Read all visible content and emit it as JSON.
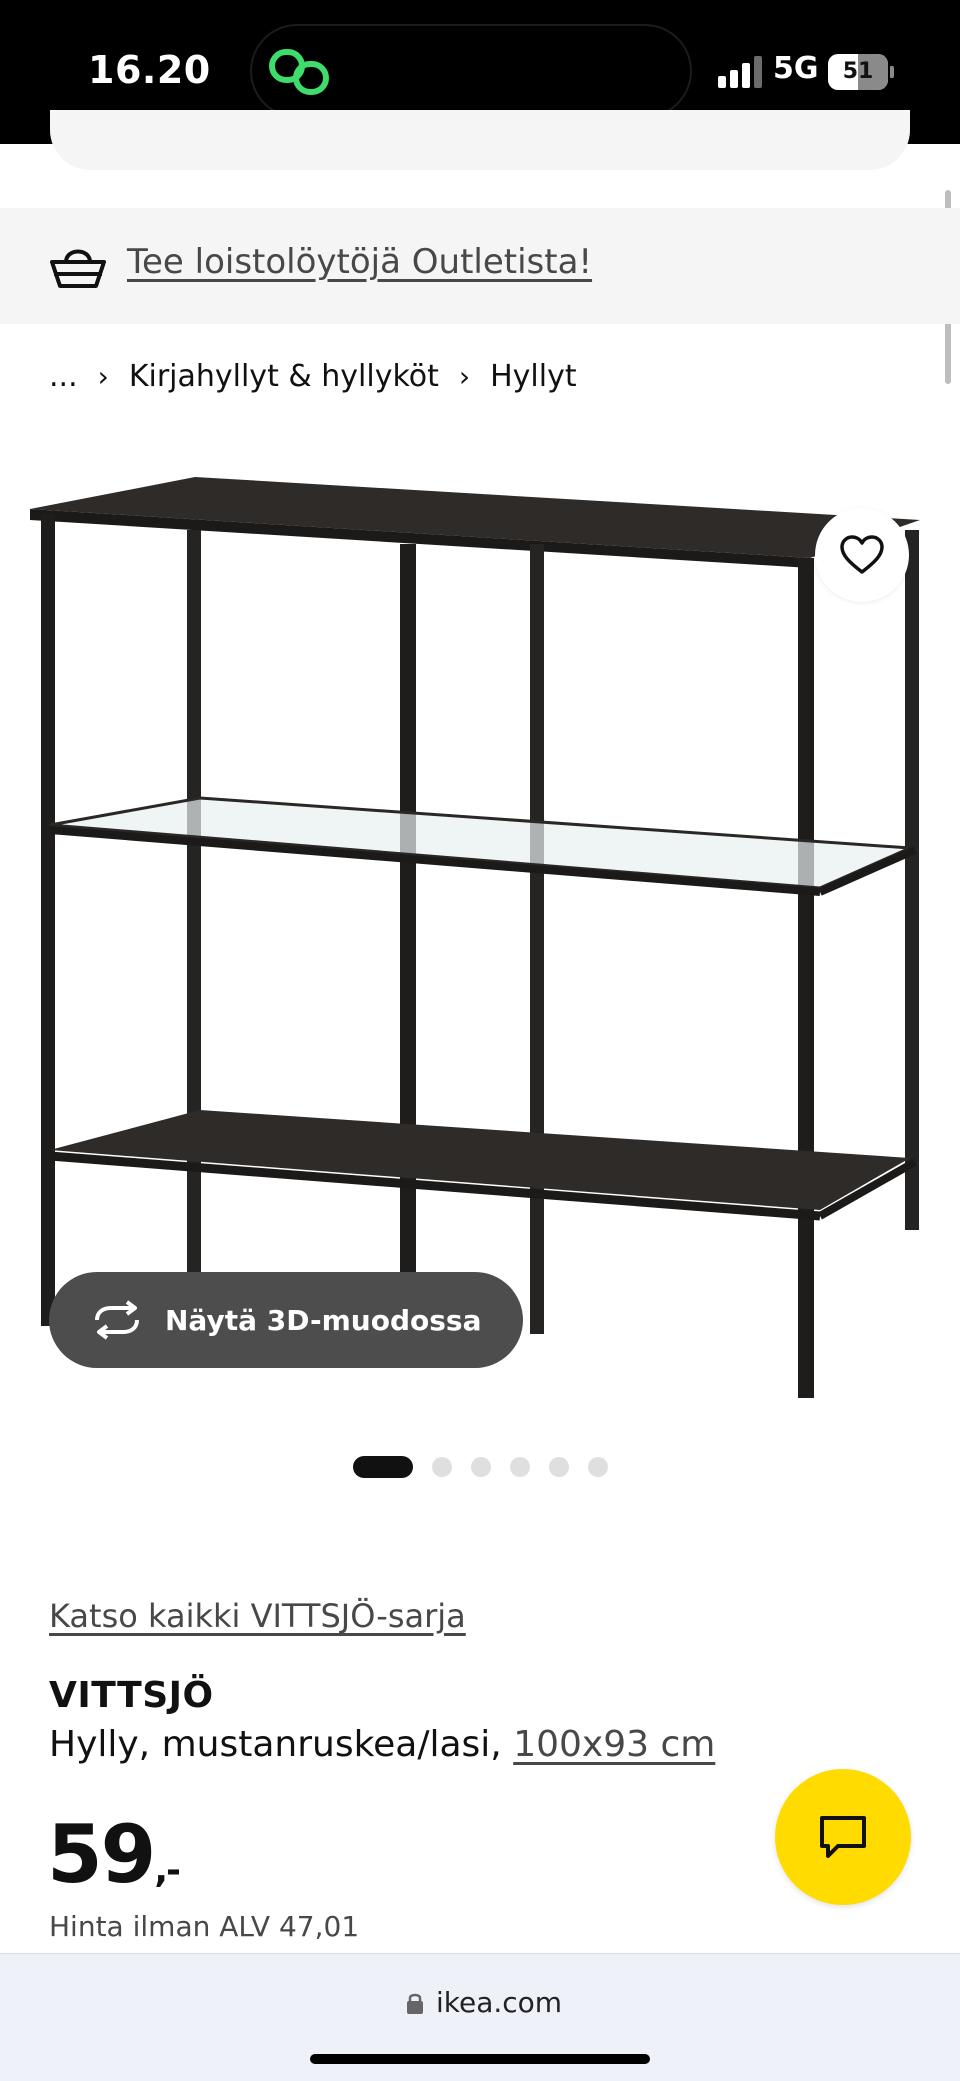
{
  "status_bar": {
    "time": "16.20",
    "network": "5G",
    "battery": "51"
  },
  "outlet_banner": {
    "text": "Tee loistolöytöjä Outletista!",
    "icon": "basket-icon"
  },
  "breadcrumb": {
    "items": [
      "...",
      "Kirjahyllyt & hyllyköt",
      "Hyllyt"
    ]
  },
  "gallery": {
    "view_3d_label": "Näytä 3D-muodossa",
    "dot_count": 6,
    "active_dot": 0
  },
  "product": {
    "series_link": "Katso kaikki VITTSJÖ-sarja",
    "name": "VITTSJÖ",
    "description": "Hylly, mustanruskea/lasi, ",
    "size": "100x93 cm",
    "price": "59",
    "price_suffix": ",-",
    "price_without_vat": "Hinta ilman ALV 47,01"
  },
  "url_bar": {
    "domain": "ikea.com"
  },
  "colors": {
    "accent_yellow": "#ffdb00",
    "dark_button": "#4d4d4d",
    "banner_bg": "#f5f5f5",
    "url_bar_bg": "#eef2f8",
    "island_icon_green": "#3ddc6b"
  }
}
